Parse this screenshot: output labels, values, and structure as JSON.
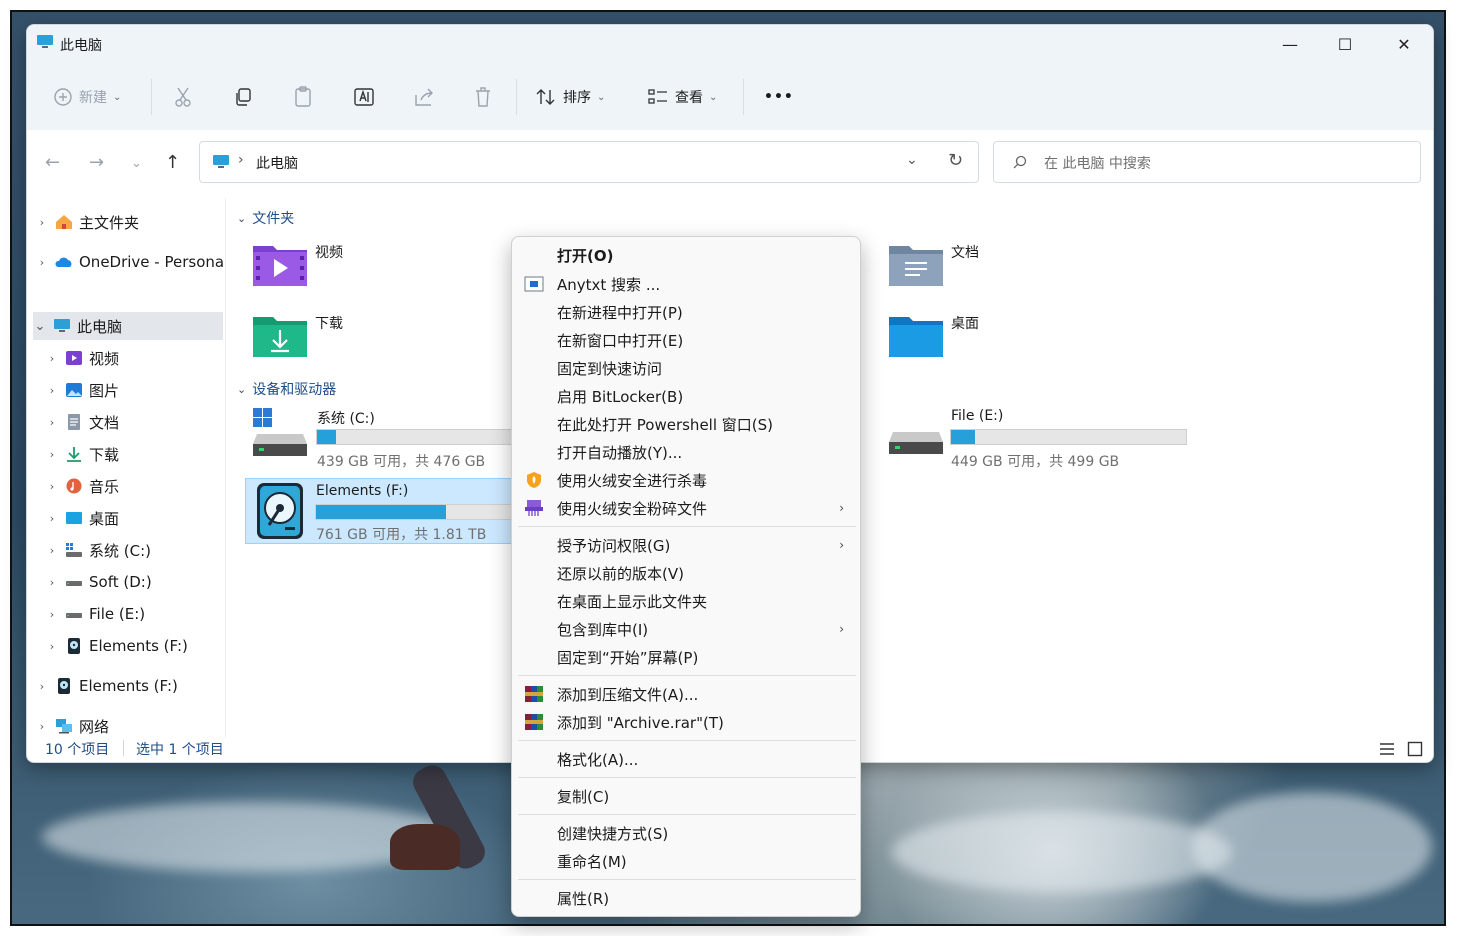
{
  "window": {
    "title": "此电脑",
    "controls": {
      "minimize": "—",
      "maximize": "☐",
      "close": "✕"
    }
  },
  "toolbar": {
    "new_label": "新建",
    "sort_label": "排序",
    "view_label": "查看",
    "more_label": "•••"
  },
  "address": {
    "separator": "›",
    "path": "此电脑",
    "search_placeholder": "在 此电脑 中搜索"
  },
  "sidebar": {
    "items": [
      {
        "label": "主文件夹",
        "icon": "home-icon"
      },
      {
        "label": "OneDrive - Persona",
        "icon": "onedrive-icon"
      },
      {
        "label": "此电脑",
        "icon": "this-pc-icon"
      },
      {
        "label": "视频",
        "icon": "videos-icon"
      },
      {
        "label": "图片",
        "icon": "pictures-icon"
      },
      {
        "label": "文档",
        "icon": "documents-icon"
      },
      {
        "label": "下载",
        "icon": "downloads-icon"
      },
      {
        "label": "音乐",
        "icon": "music-icon"
      },
      {
        "label": "桌面",
        "icon": "desktop-icon"
      },
      {
        "label": "系统 (C:)",
        "icon": "windows-drive-icon"
      },
      {
        "label": "Soft (D:)",
        "icon": "drive-icon"
      },
      {
        "label": "File (E:)",
        "icon": "drive-icon"
      },
      {
        "label": "Elements (F:)",
        "icon": "external-drive-icon"
      },
      {
        "label": "Elements (F:)",
        "icon": "external-drive-icon"
      },
      {
        "label": "网络",
        "icon": "network-icon"
      }
    ]
  },
  "content": {
    "folders_header": "文件夹",
    "drives_header": "设备和驱动器",
    "folders": [
      {
        "name": "视频",
        "icon": "videos-folder-icon"
      },
      {
        "name": "文档",
        "icon": "documents-folder-icon"
      },
      {
        "name": "下载",
        "icon": "downloads-folder-icon"
      },
      {
        "name": "桌面",
        "icon": "desktop-folder-icon"
      }
    ],
    "drives": [
      {
        "name": "系统 (C:)",
        "info": "439 GB 可用，共 476 GB",
        "used_fraction": 0.08
      },
      {
        "name": "File (E:)",
        "info": "449 GB 可用，共 499 GB",
        "used_fraction": 0.1
      },
      {
        "name": "Elements (F:)",
        "info": "761 GB 可用，共 1.81 TB",
        "used_fraction": 0.59
      }
    ]
  },
  "status": {
    "count": "10 个项目",
    "selected": "选中 1 个项目"
  },
  "context_menu": {
    "items": [
      "打开(O)",
      "Anytxt 搜索 ...",
      "在新进程中打开(P)",
      "在新窗口中打开(E)",
      "固定到快速访问",
      "启用 BitLocker(B)",
      "在此处打开 Powershell 窗口(S)",
      "打开自动播放(Y)...",
      "使用火绒安全进行杀毒",
      "使用火绒安全粉碎文件",
      "授予访问权限(G)",
      "还原以前的版本(V)",
      "在桌面上显示此文件夹",
      "包含到库中(I)",
      "固定到“开始”屏幕(P)",
      "添加到压缩文件(A)...",
      "添加到 \"Archive.rar\"(T)",
      "格式化(A)...",
      "复制(C)",
      "创建快捷方式(S)",
      "重命名(M)",
      "属性(R)"
    ],
    "submenu_arrow": "›"
  },
  "colors": {
    "accent": "#26a0da",
    "link": "#1f4e8a",
    "selection": "#cce8ff"
  }
}
